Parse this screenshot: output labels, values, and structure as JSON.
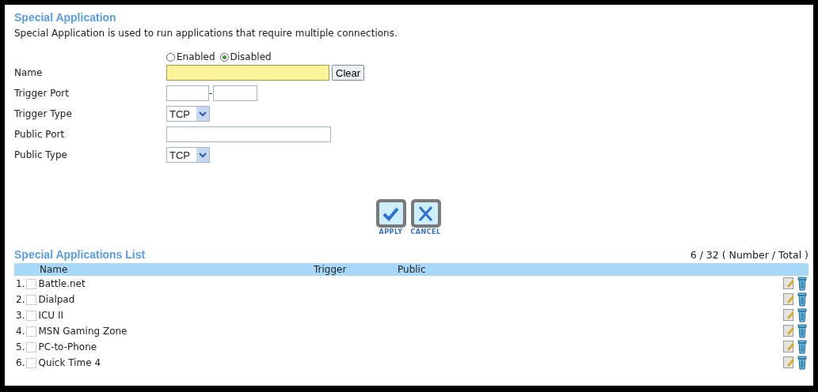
{
  "title": "Special Application",
  "description": "Special Application is used to run applications that require multiple connections.",
  "status_options": [
    {
      "label": "Enabled",
      "selected": false
    },
    {
      "label": "Disabled",
      "selected": true
    }
  ],
  "form": [
    {
      "kind": "text",
      "label": "Name",
      "highlighted": true,
      "button": "Clear"
    },
    {
      "kind": "range",
      "label": "Trigger Port",
      "separator": "-"
    },
    {
      "kind": "select",
      "label": "Trigger Type",
      "value": "TCP"
    },
    {
      "kind": "text",
      "label": "Public Port",
      "highlighted": false
    },
    {
      "kind": "select",
      "label": "Public Type",
      "value": "TCP"
    }
  ],
  "actions": [
    {
      "kind": "apply",
      "label": "APPLY"
    },
    {
      "kind": "cancel",
      "label": "CANCEL"
    }
  ],
  "list": {
    "title": "Special Applications List",
    "count": "6 / 32 ( Number / Total )",
    "columns": [
      "Name",
      "Trigger",
      "Public"
    ],
    "rows": [
      {
        "index": "1.",
        "name": "Battle.net",
        "checked": false
      },
      {
        "index": "2.",
        "name": "Dialpad",
        "checked": false
      },
      {
        "index": "3.",
        "name": "ICU II",
        "checked": false
      },
      {
        "index": "4.",
        "name": "MSN Gaming Zone",
        "checked": false
      },
      {
        "index": "5.",
        "name": "PC-to-Phone",
        "checked": false
      },
      {
        "index": "6.",
        "name": "Quick Time 4",
        "checked": false
      }
    ]
  }
}
